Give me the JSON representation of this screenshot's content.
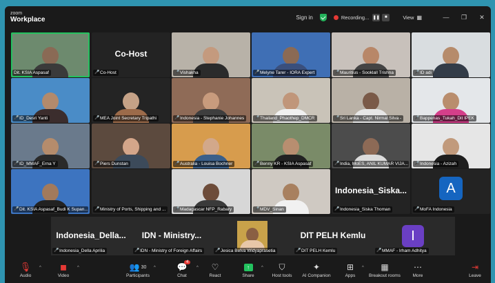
{
  "app": {
    "brand_top": "zoom",
    "brand_bottom": "Workplace"
  },
  "titlebar": {
    "sign_in": "Sign in",
    "recording": "Recording...",
    "view": "View"
  },
  "tiles": [
    {
      "label": "Dit. KSIA Aspasaf",
      "bg": "#6d8a6e",
      "skin": "#8a6a55",
      "shirt": "#3a3a3a",
      "muted": false
    },
    {
      "label": "Co-Host",
      "big": "Co-Host",
      "bg": "#232323",
      "muted": true
    },
    {
      "label": "Vishakha",
      "bg": "#b8b2a8",
      "skin": "#c49a7e",
      "shirt": "#2b2b2b",
      "muted": true
    },
    {
      "label": "Melyne Tarer - IORA Expert",
      "bg": "#3f6fb5",
      "skin": "#8b6a54",
      "shirt": "#3a4f7c",
      "muted": true
    },
    {
      "label": "Mauritius - Sooklall Trishna",
      "bg": "#c8c1bb",
      "skin": "#b88768",
      "shirt": "#444",
      "muted": true
    },
    {
      "label": "ID adi",
      "bg": "#d9dde0",
      "skin": "#b68b6b",
      "shirt": "#333c48",
      "muted": true
    },
    {
      "label": "ID_Desri Yanti",
      "bg": "#4a8cc7",
      "skin": "#b28a6c",
      "shirt": "#3b2d2d",
      "muted": true
    },
    {
      "label": "MEA Joint Secretary Tripathi",
      "bg": "#242424",
      "skin": "#c5a287",
      "shirt": "#9c6b4a",
      "muted": true
    },
    {
      "label": "Indonesia - Stephanie Johannes",
      "bg": "#8f6b57",
      "skin": "#c89b7d",
      "shirt": "#3e3e3e",
      "muted": true
    },
    {
      "label": "Thailand_Phaothep_DMCR",
      "bg": "#c9c3b8",
      "skin": "#c0967a",
      "shirt": "#f0f0f0",
      "muted": true
    },
    {
      "label": "Sri Lanka - Capt. Nirmal Silva -",
      "bg": "#b9b1a6",
      "skin": "#7a5a48",
      "shirt": "#e6e6e6",
      "muted": true
    },
    {
      "label": "Bappenas_Tukah_Dit IPEK",
      "bg": "#e4e7ea",
      "skin": "#b98d6d",
      "shirt": "#d43f8a",
      "muted": true
    },
    {
      "label": "ID_MMAF_Erna Y",
      "bg": "#6a7a8c",
      "skin": "#b58c6c",
      "shirt": "#2a2a2a",
      "muted": true
    },
    {
      "label": "Piers Dunstan",
      "bg": "#5c4a3e",
      "skin": "#d4a68a",
      "shirt": "#3c4a5a",
      "muted": true
    },
    {
      "label": "Australia - Louisa Bochner",
      "bg": "#d79c4d",
      "skin": "#d2a88a",
      "shirt": "#3a5f8a",
      "muted": true
    },
    {
      "label": "Benny KR - KSIA Aspasaf",
      "bg": "#7a8b68",
      "skin": "#b88e70",
      "shirt": "#222",
      "muted": true
    },
    {
      "label": "India, MoES, ANIL KUMAR VIJA...",
      "bg": "#4c4c4c",
      "skin": "#8d6a56",
      "shirt": "#dcdcdc",
      "muted": true
    },
    {
      "label": "Indonesia - Azizah",
      "bg": "#e6e6e6",
      "skin": "#c19a7c",
      "shirt": "#1e1e1e",
      "muted": true
    },
    {
      "label": "Dit. KSIA Aspasaf_Budi K Supan...",
      "bg": "#3d74c0",
      "skin": "#a27a5c",
      "shirt": "#222",
      "muted": true
    },
    {
      "label": "Ministry of Ports, Shipping and ...",
      "bg": "#262626",
      "muted": true
    },
    {
      "label": "Madagascar NFP_Rabary",
      "bg": "#d7d7d7",
      "skin": "#6d4c3a",
      "shirt": "#3a3a3a",
      "muted": true
    },
    {
      "label": "MDV_Sinan",
      "bg": "#cfc9c2",
      "skin": "#a8805f",
      "shirt": "#f1f1f1",
      "muted": true
    },
    {
      "label": "Indonesia_Siska Thoman",
      "big": "Indonesia_Siska...",
      "bg": "#232323",
      "muted": true
    },
    {
      "label": "MoFA Indonesia",
      "avatar": "A",
      "avatar_color": "#1565c0",
      "bg": "#232323",
      "muted": true
    }
  ],
  "strip": [
    {
      "label": "Indonesia_Della Aprilia",
      "big": "Indonesia_Della...",
      "muted": true
    },
    {
      "label": "IDN - Ministry of Foreign Affairs",
      "big": "IDN - Ministry...",
      "muted": true
    },
    {
      "label": "Jesica Belva Widyaprasetia",
      "photo": true,
      "muted": true
    },
    {
      "label": "DIT PELH Kemlu",
      "big": "DIT PELH Kemlu",
      "muted": true
    },
    {
      "label": "MMAF - Irham Adhitya",
      "avatar": "I",
      "avatar_color": "#6a3fc4",
      "muted": true
    }
  ],
  "toolbar": {
    "audio": "Audio",
    "video": "Video",
    "participants": "Participants",
    "participants_count": "30",
    "chat": "Chat",
    "chat_badge": "4",
    "react": "React",
    "share": "Share",
    "host_tools": "Host tools",
    "ai_companion": "AI Companion",
    "apps": "Apps",
    "breakout_rooms": "Breakout rooms",
    "more": "More",
    "leave": "Leave"
  },
  "colors": {
    "accent_green": "#23c25f",
    "danger_red": "#e53935",
    "background": "#2f94b0"
  }
}
